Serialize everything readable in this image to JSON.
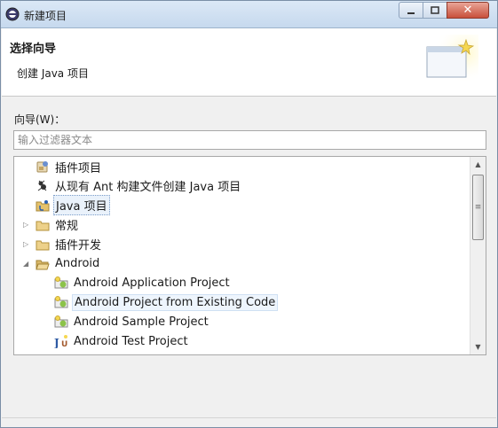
{
  "window": {
    "title": "新建项目"
  },
  "header": {
    "title": "选择向导",
    "subtitle": "创建 Java 项目"
  },
  "wizard": {
    "label": "向导(W)：",
    "filter_placeholder": "输入过滤器文本",
    "tree": [
      {
        "label": "插件项目",
        "icon": "plugin-project-icon",
        "level": 1,
        "arrow": "none"
      },
      {
        "label": "从现有 Ant 构建文件创建 Java 项目",
        "icon": "ant-icon",
        "level": 1,
        "arrow": "none"
      },
      {
        "label": "Java 项目",
        "icon": "java-project-icon",
        "level": 1,
        "arrow": "none",
        "selected": true
      },
      {
        "label": "常规",
        "icon": "folder-icon",
        "level": 1,
        "arrow": "collapsed"
      },
      {
        "label": "插件开发",
        "icon": "folder-icon",
        "level": 1,
        "arrow": "collapsed"
      },
      {
        "label": "Android",
        "icon": "folder-open-icon",
        "level": 1,
        "arrow": "expanded"
      },
      {
        "label": "Android Application Project",
        "icon": "android-project-icon",
        "level": 2,
        "arrow": "none"
      },
      {
        "label": "Android Project from Existing Code",
        "icon": "android-project-icon",
        "level": 2,
        "arrow": "none",
        "highlight": true
      },
      {
        "label": "Android Sample Project",
        "icon": "android-project-icon",
        "level": 2,
        "arrow": "none"
      },
      {
        "label": "Android Test Project",
        "icon": "junit-icon",
        "level": 2,
        "arrow": "none"
      }
    ]
  },
  "colors": {
    "accent": "#7b9dc9",
    "close": "#c8503b"
  }
}
